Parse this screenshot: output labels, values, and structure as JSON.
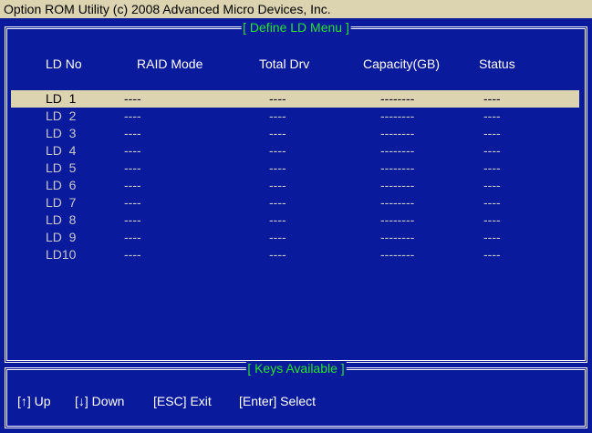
{
  "titlebar": "Option ROM Utility (c) 2008 Advanced Micro Devices, Inc.",
  "main_panel_title": "[ Define LD Menu ]",
  "keys_panel_title": "[ Keys Available ]",
  "columns": [
    "LD No",
    "RAID Mode",
    "Total Drv",
    "Capacity(GB)",
    "Status"
  ],
  "rows": [
    {
      "ld": "LD  1",
      "raid": "----",
      "drv": "----",
      "cap": "--------",
      "status": "----"
    },
    {
      "ld": "LD  2",
      "raid": "----",
      "drv": "----",
      "cap": "--------",
      "status": "----"
    },
    {
      "ld": "LD  3",
      "raid": "----",
      "drv": "----",
      "cap": "--------",
      "status": "----"
    },
    {
      "ld": "LD  4",
      "raid": "----",
      "drv": "----",
      "cap": "--------",
      "status": "----"
    },
    {
      "ld": "LD  5",
      "raid": "----",
      "drv": "----",
      "cap": "--------",
      "status": "----"
    },
    {
      "ld": "LD  6",
      "raid": "----",
      "drv": "----",
      "cap": "--------",
      "status": "----"
    },
    {
      "ld": "LD  7",
      "raid": "----",
      "drv": "----",
      "cap": "--------",
      "status": "----"
    },
    {
      "ld": "LD  8",
      "raid": "----",
      "drv": "----",
      "cap": "--------",
      "status": "----"
    },
    {
      "ld": "LD  9",
      "raid": "----",
      "drv": "----",
      "cap": "--------",
      "status": "----"
    },
    {
      "ld": "LD10",
      "raid": "----",
      "drv": "----",
      "cap": "--------",
      "status": "----"
    }
  ],
  "selected_index": 0,
  "keys": [
    "[↑] Up",
    "[↓] Down",
    "[ESC] Exit",
    "[Enter] Select"
  ],
  "colors": {
    "background": "#0a1a9c",
    "titlebar": "#dcd3b0",
    "highlight": "#dcd3b0",
    "panel_title": "#26e22a",
    "text": "#ffffff"
  }
}
